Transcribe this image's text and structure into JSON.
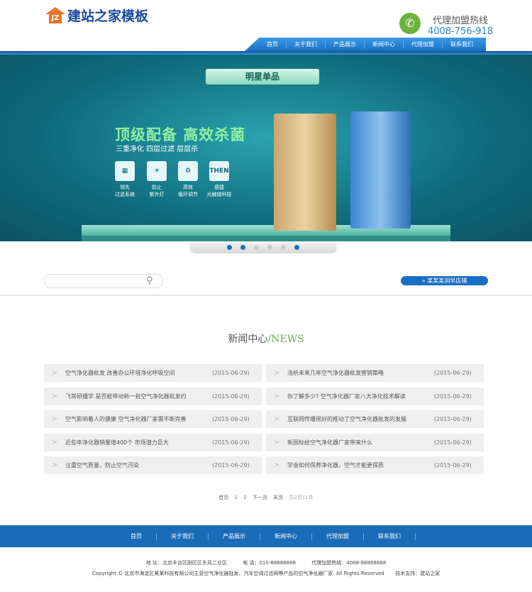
{
  "header": {
    "logo_text": "建站之家模板",
    "logo_mark": "JZ",
    "hotline_label": "代理加盟热线",
    "hotline_number": "4008-756-918"
  },
  "nav": [
    "首页",
    "关于我们",
    "产品展示",
    "新闻中心",
    "代理加盟",
    "联系我们"
  ],
  "banner": {
    "ribbon": "明星单品",
    "title": "顶级配备 高效杀菌",
    "subtitle": "三重净化 四层过滤 层层杀",
    "features": [
      {
        "icon": "",
        "l1": "领先",
        "l2": "过滤系统"
      },
      {
        "icon": "",
        "l1": "防止",
        "l2": "紫外灯"
      },
      {
        "icon": "♻",
        "l1": "高效",
        "l2": "循环调节"
      },
      {
        "icon": "THEN",
        "l1": "便捷",
        "l2": "光触媒科技"
      }
    ]
  },
  "search": {
    "placeholder": "",
    "hot_button": "»  某某某洞早店铺"
  },
  "news": {
    "title": "新闻中心",
    "title_en": "/NEWS",
    "left": [
      {
        "t": "空气净化器批发 改善办公环境净化呼吸空间",
        "d": "(2015-06-29)"
      },
      {
        "t": "飞常研播学 是否能带动新一批空气净化器批发约",
        "d": "(2015-06-29)"
      },
      {
        "t": "空气影响着人的健康 空气净化器厂家需不断完善",
        "d": "(2015-06-29)"
      },
      {
        "t": "近些年净化器销量增400个 市场潜力巨大",
        "d": "(2015-06-29)"
      },
      {
        "t": "注重空气质量，防止空气污染",
        "d": "(2015-06-29)"
      }
    ],
    "right": [
      {
        "t": "浅析未来几年空气净化器批发营销策略",
        "d": "(2015-06-29)"
      },
      {
        "t": "你了解多少? 空气净化器厂家八大净化技术解读",
        "d": "(2015-06-29)"
      },
      {
        "t": "互联网传播很好的推动了空气净化器批发的发展",
        "d": "(2015-06-29)"
      },
      {
        "t": "新国标给空气净化器厂家带来什么",
        "d": "(2015-06-29)"
      },
      {
        "t": "学会如何保养净化器，空气才能更保质",
        "d": "(2015-06-29)"
      }
    ]
  },
  "pager": {
    "first": "首页",
    "p1": "1",
    "p2": "2",
    "next": "下一页",
    "last": "末页",
    "info": "共2页11条"
  },
  "footer": {
    "nav": [
      "首页",
      "关于我们",
      "产品展示",
      "新闻中心",
      "代理加盟",
      "联系我们"
    ],
    "address": "地 址：北京丰台区刚区区东风二业区",
    "phone": "电 话：010-88888888",
    "hotline": "代理加盟热线：4008-88888888",
    "copyright": "Copyright © 北京市海淀区某某科技有限公司主营空气净化器批发、汽车空调过滤网等产品的空气净化器厂家. All Rights Reserved",
    "support": "技术支持：建站之家"
  }
}
